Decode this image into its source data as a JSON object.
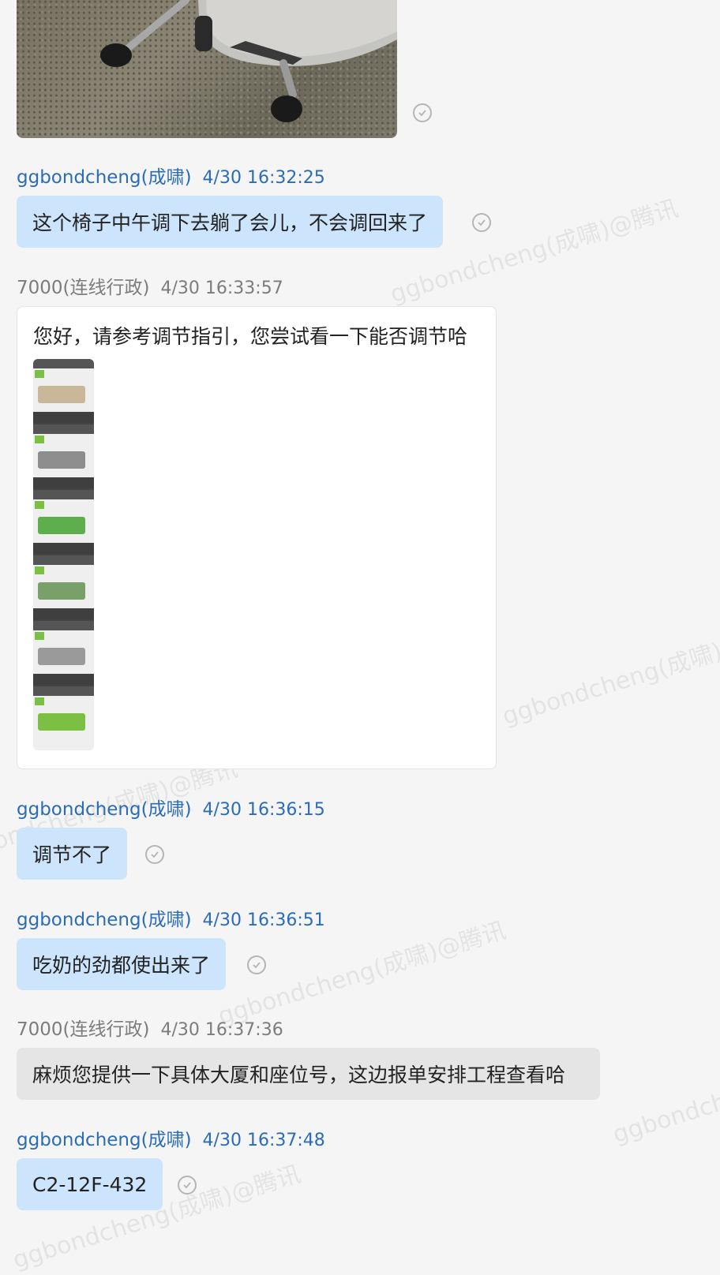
{
  "watermark": "ggbondcheng(成啸)@腾讯",
  "messages": [
    {
      "sender": "ggbondcheng(成啸)",
      "time": "4/30 16:32:25",
      "text": "这个椅子中午调下去躺了会儿，不会调回来了"
    },
    {
      "sender": "7000(连线行政)",
      "time": "4/30 16:33:57",
      "text": "您好，请参考调节指引，您尝试看一下能否调节哈"
    },
    {
      "sender": "ggbondcheng(成啸)",
      "time": "4/30 16:36:15",
      "text": "调节不了"
    },
    {
      "sender": "ggbondcheng(成啸)",
      "time": "4/30 16:36:51",
      "text": "吃奶的劲都使出来了"
    },
    {
      "sender": "7000(连线行政)",
      "time": "4/30 16:37:36",
      "text": "麻烦您提供一下具体大厦和座位号，这边报单安排工程查看哈"
    },
    {
      "sender": "ggbondcheng(成啸)",
      "time": "4/30 16:37:48",
      "text": "C2-12F-432"
    }
  ],
  "icons": {
    "read_receipt": "check-circle-icon",
    "chair_photo": "office-chair-photo",
    "guide_image": "adjustment-guide-image"
  },
  "colors": {
    "self_bubble": "#cce4fc",
    "other_bubble": "#e5e5e5",
    "self_name": "#2b6cb8",
    "other_name": "#7c7c7c"
  }
}
